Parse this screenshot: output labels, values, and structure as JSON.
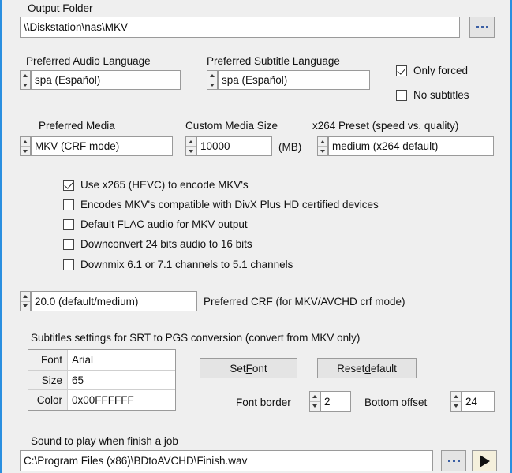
{
  "theme": {
    "accent_border": "#2a8fe0",
    "background": "#efefef",
    "field_background": "#ffffff",
    "button_background": "#e4e4e4",
    "play_button_background": "#f5f0dc",
    "text": "#111111"
  },
  "output_folder": {
    "label": "Output Folder",
    "value": "\\\\Diskstation\\nas\\MKV",
    "browse_button": "...",
    "browse_icon": "ellipsis-icon"
  },
  "audio_language": {
    "label": "Preferred Audio Language",
    "value": "spa (Español)"
  },
  "subtitle_language": {
    "label": "Preferred Subtitle Language",
    "value": "spa (Español)"
  },
  "subtitle_options": [
    {
      "label": "Only forced",
      "checked": true
    },
    {
      "label": "No subtitles",
      "checked": false
    }
  ],
  "preferred_media": {
    "label": "Preferred Media",
    "value": "MKV (CRF mode)"
  },
  "custom_media_size": {
    "label": "Custom Media Size",
    "value": "10000",
    "unit": "(MB)"
  },
  "x264_preset": {
    "label": "x264 Preset (speed vs. quality)",
    "value": "medium (x264 default)"
  },
  "encode_options": [
    {
      "label": "Use x265 (HEVC) to encode MKV's",
      "checked": true
    },
    {
      "label": "Encodes MKV's compatible with DivX Plus HD certified devices",
      "checked": false
    },
    {
      "label": "Default FLAC audio for MKV output",
      "checked": false
    },
    {
      "label": "Downconvert 24 bits audio to 16 bits",
      "checked": false
    },
    {
      "label": "Downmix 6.1 or 7.1 channels to 5.1 channels",
      "checked": false
    }
  ],
  "crf": {
    "value": "20.0 (default/medium)",
    "label": "Preferred CRF (for MKV/AVCHD crf mode)"
  },
  "subtitles_section": {
    "title": "Subtitles settings for SRT to PGS conversion (convert from MKV only)",
    "table": [
      {
        "key": "Font",
        "value": "Arial"
      },
      {
        "key": "Size",
        "value": "65"
      },
      {
        "key": "Color",
        "value": "0x00FFFFFF"
      }
    ],
    "set_font_button": {
      "pre": "Set ",
      "accel": "F",
      "post": "ont"
    },
    "reset_default_button": {
      "pre": "Reset ",
      "accel": "d",
      "post": "efault"
    },
    "font_border": {
      "label": "Font border",
      "value": "2"
    },
    "bottom_offset": {
      "label": "Bottom offset",
      "value": "24"
    }
  },
  "sound": {
    "label": "Sound to play when finish a job",
    "value": "C:\\Program Files (x86)\\BDtoAVCHD\\Finish.wav",
    "browse_button": "...",
    "browse_icon": "ellipsis-icon",
    "play_icon": "play-triangle-icon"
  }
}
